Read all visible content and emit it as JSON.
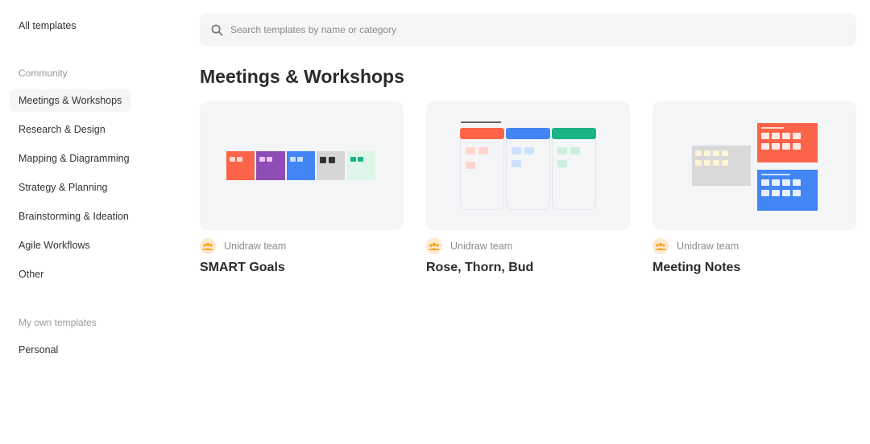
{
  "sidebar": {
    "all_templates": "All templates",
    "community_heading": "Community",
    "categories": [
      "Meetings & Workshops",
      "Research & Design",
      "Mapping & Diagramming",
      "Strategy & Planning",
      "Brainstorming & Ideation",
      "Agile Workflows",
      "Other"
    ],
    "active_category": "Meetings & Workshops",
    "own_heading": "My own templates",
    "personal": "Personal"
  },
  "search": {
    "placeholder": "Search templates by name or category",
    "value": ""
  },
  "main": {
    "section_title": "Meetings & Workshops",
    "cards": [
      {
        "title": "SMART Goals",
        "author": "Unidraw team"
      },
      {
        "title": "Rose, Thorn, Bud",
        "author": "Unidraw team"
      },
      {
        "title": "Meeting Notes",
        "author": "Unidraw team"
      }
    ]
  },
  "colors": {
    "red": "#fb6448",
    "purple": "#8e4cb5",
    "blue": "#4285f4",
    "gray": "#d6d6d6",
    "green": "#18b486",
    "light_green": "#dff5e7",
    "avatar_bg": "#fde9cf",
    "avatar_fg": "#f5a623"
  },
  "icons": {
    "search": "search-icon",
    "avatar": "team-avatar-icon"
  }
}
